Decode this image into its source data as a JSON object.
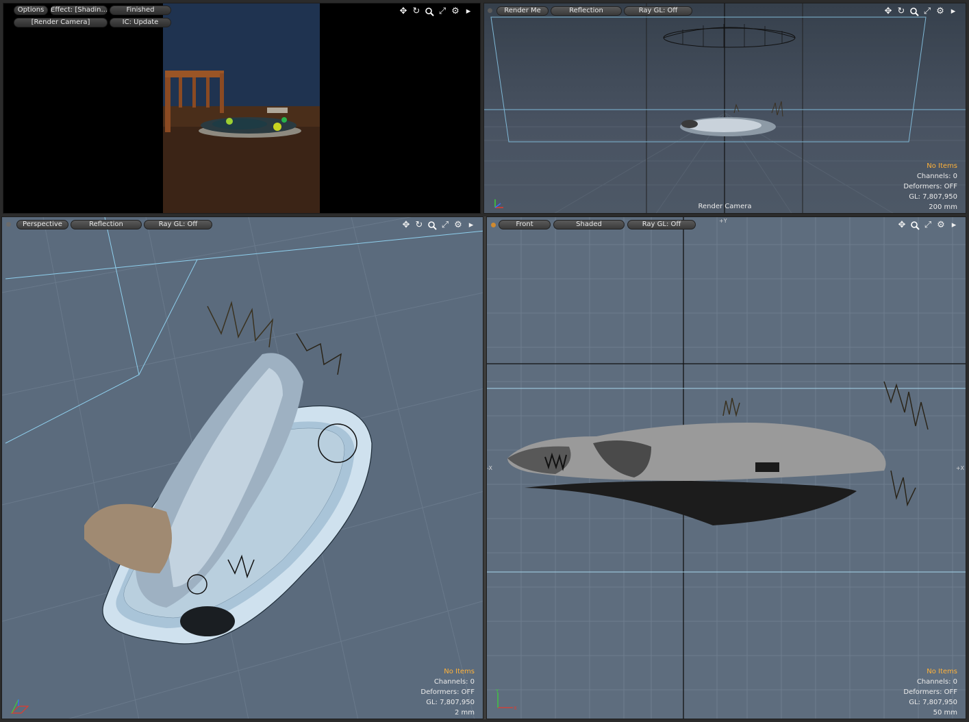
{
  "render_view": {
    "options_label": "Options",
    "effect_label": "Effect: [Shadin...",
    "status_label": "Finished",
    "camera_label": "[Render Camera]",
    "ic_label": "IC: Update"
  },
  "camera_view": {
    "view_label": "Render Me",
    "shading_label": "Reflection",
    "raygl_label": "Ray GL: Off",
    "camera_name": "Render Camera",
    "info": {
      "items": "No Items",
      "channels": "Channels: 0",
      "deformers": "Deformers: OFF",
      "gl": "GL: 7,807,950",
      "scale": "200 mm"
    }
  },
  "perspective_view": {
    "view_label": "Perspective",
    "shading_label": "Reflection",
    "raygl_label": "Ray GL: Off",
    "info": {
      "items": "No Items",
      "channels": "Channels: 0",
      "deformers": "Deformers: OFF",
      "gl": "GL: 7,807,950",
      "scale": "2 mm"
    }
  },
  "front_view": {
    "view_label": "Front",
    "shading_label": "Shaded",
    "raygl_label": "Ray GL: Off",
    "axis_y_top": "+Y",
    "axis_x_left": "-X",
    "axis_x_right": "+X",
    "info": {
      "items": "No Items",
      "channels": "Channels: 0",
      "deformers": "Deformers: OFF",
      "gl": "GL: 7,807,950",
      "scale": "50 mm"
    }
  },
  "icons": [
    "move-icon",
    "rotate-icon",
    "zoom-icon",
    "maximize-icon",
    "settings-gear-icon",
    "expand-arrow-icon"
  ],
  "colors": {
    "accent_orange": "#ffb23a",
    "viewport_blue": "#5b6b7d",
    "axis_x": "#e33b2e",
    "axis_y": "#3bd13b",
    "axis_z": "#3a6bff"
  }
}
